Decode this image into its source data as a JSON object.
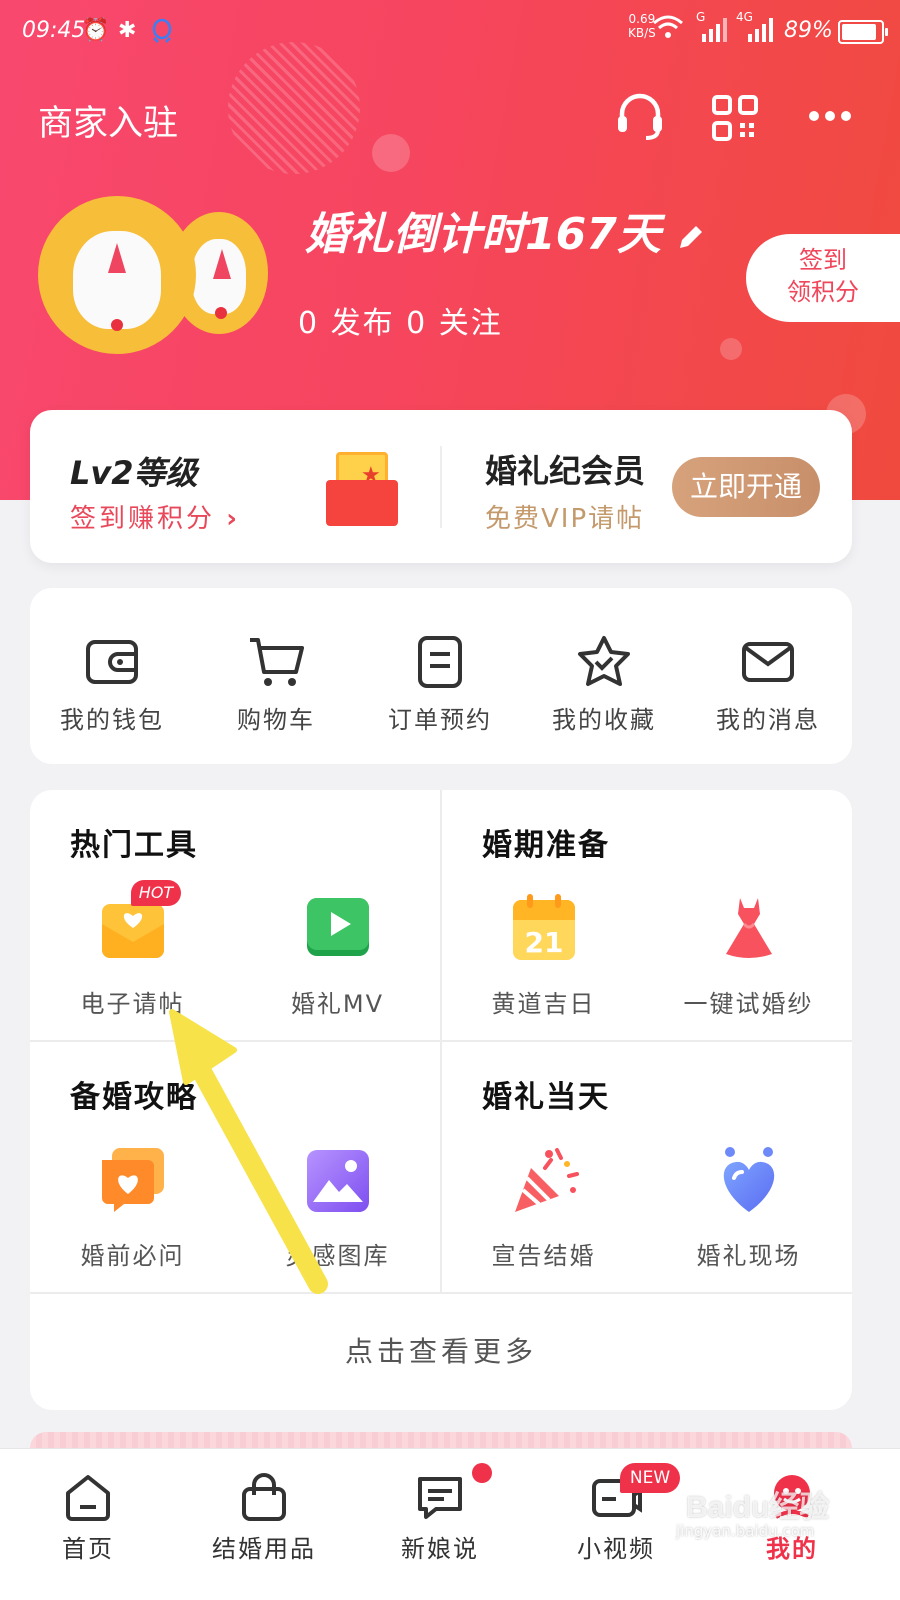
{
  "status_bar": {
    "time": "09:45",
    "net_speed_value": "0.69",
    "net_speed_unit": "KB/S",
    "network_label_a": "G",
    "network_label_b": "4G",
    "battery": "89%",
    "battery_level": 0.89
  },
  "header": {
    "merchant_label": "商家入驻",
    "countdown": "婚礼倒计时167天",
    "stats": "0 发布 0 关注",
    "signin_line1": "签到",
    "signin_line2": "领积分"
  },
  "vip_card": {
    "level_title": "Lv2等级",
    "level_sub": "签到赚积分",
    "vip_title": "婚礼纪会员",
    "vip_sub": "免费VIP请帖",
    "open_button": "立即开通"
  },
  "quick_links": [
    {
      "label": "我的钱包",
      "icon": "wallet-icon"
    },
    {
      "label": "购物车",
      "icon": "cart-icon"
    },
    {
      "label": "订单预约",
      "icon": "order-icon"
    },
    {
      "label": "我的收藏",
      "icon": "favorites-icon"
    },
    {
      "label": "我的消息",
      "icon": "message-icon"
    }
  ],
  "sections": [
    {
      "title": "热门工具",
      "tools": [
        {
          "label": "电子请帖",
          "icon": "invitation-icon",
          "badge": "HOT"
        },
        {
          "label": "婚礼MV",
          "icon": "video-play-icon"
        }
      ]
    },
    {
      "title": "婚期准备",
      "tools": [
        {
          "label": "黄道吉日",
          "icon": "calendar-icon",
          "icon_text": "21"
        },
        {
          "label": "一键试婚纱",
          "icon": "wedding-dress-icon"
        }
      ]
    },
    {
      "title": "备婚攻略",
      "tools": [
        {
          "label": "婚前必问",
          "icon": "heart-chat-icon"
        },
        {
          "label": "灵感图库",
          "icon": "gallery-icon"
        }
      ]
    },
    {
      "title": "婚礼当天",
      "tools": [
        {
          "label": "宣告结婚",
          "icon": "party-popper-icon"
        },
        {
          "label": "婚礼现场",
          "icon": "heart-venue-icon"
        }
      ]
    }
  ],
  "more_link": "点击查看更多",
  "tabbar": [
    {
      "label": "首页",
      "icon": "home-icon"
    },
    {
      "label": "结婚用品",
      "icon": "shopping-bag-icon"
    },
    {
      "label": "新娘说",
      "icon": "chat-icon"
    },
    {
      "label": "小视频",
      "icon": "video-icon",
      "badge": "NEW"
    },
    {
      "label": "我的",
      "icon": "profile-icon",
      "active": true
    }
  ],
  "watermark": {
    "brand": "Baidu经验",
    "url": "jingyan.baidu.com"
  },
  "colors": {
    "primary_red": "#f6455e",
    "gold": "#c8906a",
    "badge_red": "#f0314a",
    "annotation_arrow": "#f7e24a"
  }
}
